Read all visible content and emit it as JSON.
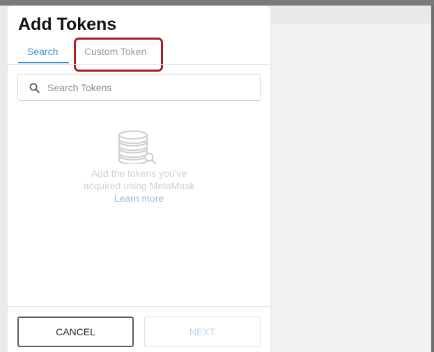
{
  "dialog": {
    "title": "Add Tokens"
  },
  "tabs": [
    {
      "label": "Search",
      "active": true
    },
    {
      "label": "Custom Token",
      "active": false
    }
  ],
  "search": {
    "placeholder": "Search Tokens",
    "value": ""
  },
  "empty_state": {
    "icon": "coins-search-icon",
    "line1": "Add the tokens you've",
    "line2": "acquired using MetaMask",
    "link": "Learn more"
  },
  "footer": {
    "cancel_label": "CANCEL",
    "next_label": "NEXT"
  },
  "colors": {
    "accent": "#3a8fd6",
    "highlight": "#a61e22"
  }
}
